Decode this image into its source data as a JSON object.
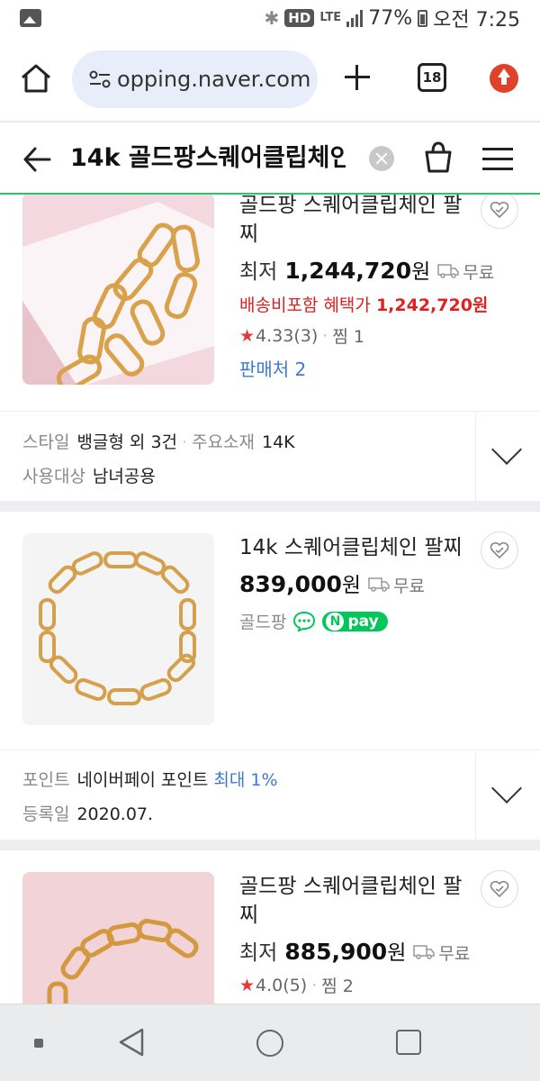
{
  "status_bar": {
    "hd": "HD",
    "network": "LTE",
    "battery": "77%",
    "time": "오전 7:25"
  },
  "browser": {
    "url": "opping.naver.com",
    "tab_count": "18"
  },
  "search": {
    "query": "14k 골드팡스퀘어클립체인"
  },
  "products": [
    {
      "title": "골드팡 스퀘어클립체인 팔찌",
      "lowest_label": "최저",
      "price": "1,244,720",
      "won": "원",
      "shipping": "무료",
      "benefit_label": "배송비포함 혜택가",
      "benefit_price": "1,242,720원",
      "rating": "4.33",
      "reviews": "(3)",
      "wish_label": "찜 1",
      "sellers": "판매처 2"
    },
    {
      "title": "14k 스퀘어클립체인 팔찌",
      "price": "839,000",
      "won": "원",
      "shipping": "무료",
      "store": "골드팡",
      "npay": "pay"
    },
    {
      "title": "골드팡 스퀘어클립체인 팔찌",
      "lowest_label": "최저",
      "price": "885,900",
      "won": "원",
      "shipping": "무료",
      "rating": "4.0",
      "reviews": "(5)",
      "wish_label": "찜 2"
    }
  ],
  "attributes": [
    {
      "style_key": "스타일",
      "style_value": "뱅글형 외 3건",
      "material_key": "주요소재",
      "material_value": "14K",
      "target_key": "사용대상",
      "target_value": "남녀공용"
    },
    {
      "point_key": "포인트",
      "point_value": "네이버페이 포인트",
      "point_max": "최대 1%",
      "date_key": "등록일",
      "date_value": "2020.07."
    }
  ],
  "colors": {
    "accent_green": "#27c76e",
    "npay_green": "#03c75a",
    "price_red": "#d22222",
    "link_blue": "#3c7ad8",
    "star_red": "#e63737"
  }
}
